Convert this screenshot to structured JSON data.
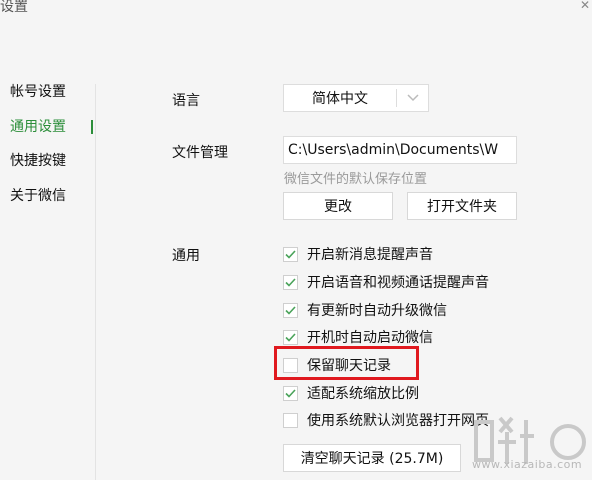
{
  "window": {
    "title": "设置"
  },
  "sidebar": {
    "items": [
      {
        "label": "帐号设置"
      },
      {
        "label": "通用设置"
      },
      {
        "label": "快捷按键"
      },
      {
        "label": "关于微信"
      }
    ],
    "active_color": "#2c8e3a"
  },
  "language": {
    "label": "语言",
    "value": "简体中文",
    "arrow_icon": "chevron-down-icon"
  },
  "file_management": {
    "label": "文件管理",
    "path": "C:\\Users\\admin\\Documents\\W",
    "hint": "微信文件的默认保存位置",
    "change_label": "更改",
    "open_folder_label": "打开文件夹"
  },
  "general": {
    "label": "通用",
    "options": [
      {
        "label": "开启新消息提醒声音",
        "checked": true
      },
      {
        "label": "开启语音和视频通话提醒声音",
        "checked": true
      },
      {
        "label": "有更新时自动升级微信",
        "checked": true
      },
      {
        "label": "开机时自动启动微信",
        "checked": true
      },
      {
        "label": "保留聊天记录",
        "checked": false
      },
      {
        "label": "适配系统缩放比例",
        "checked": true
      },
      {
        "label": "使用系统默认浏览器打开网页",
        "checked": false
      }
    ],
    "clear_history_label": "清空聊天记录 (25.7M)"
  },
  "watermark": {
    "text": "www.xiazaiba.com"
  },
  "colors": {
    "check": "#4aa35a",
    "highlight": "#e0191f"
  }
}
